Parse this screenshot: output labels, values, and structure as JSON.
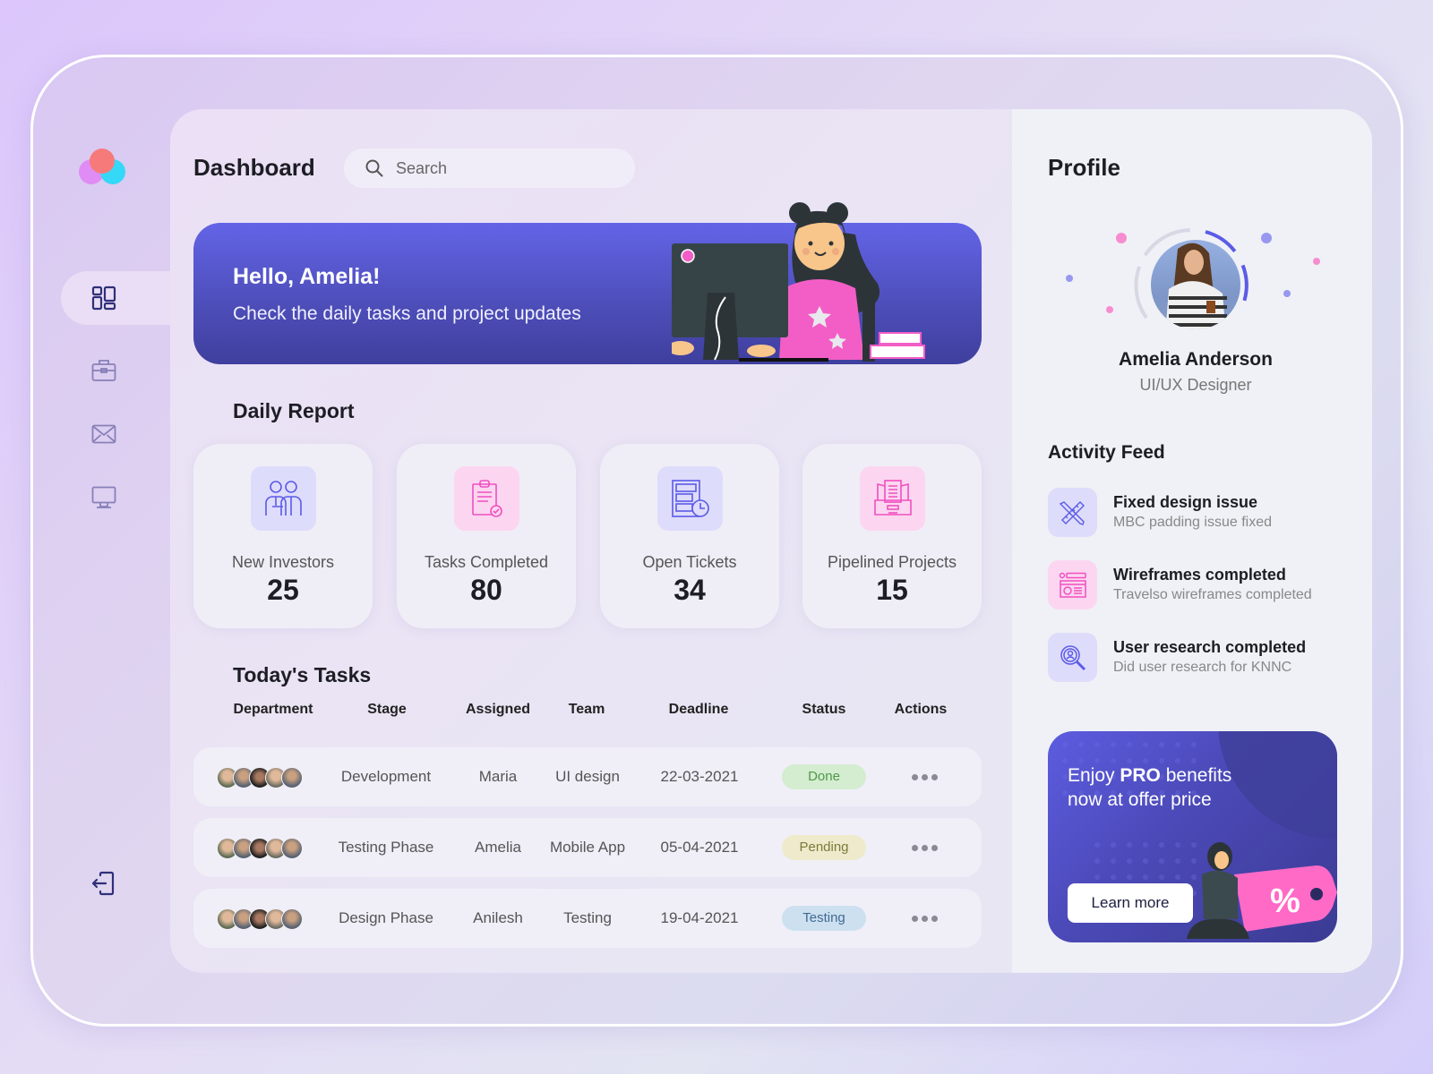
{
  "app": {
    "title": "Dashboard"
  },
  "search": {
    "placeholder": "Search",
    "value": ""
  },
  "sidebar": {
    "items": [
      {
        "name": "dashboard",
        "icon": "grid-icon",
        "active": true
      },
      {
        "name": "projects",
        "icon": "briefcase-icon",
        "active": false
      },
      {
        "name": "messages",
        "icon": "mail-icon",
        "active": false
      },
      {
        "name": "monitor",
        "icon": "monitor-icon",
        "active": false
      }
    ],
    "logout_icon": "logout-icon"
  },
  "hero": {
    "greeting": "Hello, Amelia!",
    "subtitle": "Check the daily tasks and project updates"
  },
  "daily_report": {
    "title": "Daily Report",
    "cards": [
      {
        "label": "New Investors",
        "value": "25",
        "icon": "investors-icon",
        "tint": "#dedcfb",
        "color": "#5b5be6"
      },
      {
        "label": "Tasks Completed",
        "value": "80",
        "icon": "clipboard-check-icon",
        "tint": "#fcd6f0",
        "color": "#f04fc0"
      },
      {
        "label": "Open Tickets",
        "value": "34",
        "icon": "tickets-clock-icon",
        "tint": "#dedcfb",
        "color": "#5b5be6"
      },
      {
        "label": "Pipelined Projects",
        "value": "15",
        "icon": "inbox-tray-icon",
        "tint": "#fcd6f0",
        "color": "#f04fc0"
      }
    ]
  },
  "tasks": {
    "title": "Today's Tasks",
    "columns": [
      "Department",
      "Stage",
      "Assigned",
      "Team",
      "Deadline",
      "Status",
      "Actions"
    ],
    "rows": [
      {
        "stage": "Development",
        "assigned": "Maria",
        "team": "UI design",
        "deadline": "22-03-2021",
        "status": "Done"
      },
      {
        "stage": "Testing Phase",
        "assigned": "Amelia",
        "team": "Mobile App",
        "deadline": "05-04-2021",
        "status": "Pending"
      },
      {
        "stage": "Design Phase",
        "assigned": "Anilesh",
        "team": "Testing",
        "deadline": "19-04-2021",
        "status": "Testing"
      }
    ],
    "status_colors": {
      "Done": {
        "bg": "#d4ecd0",
        "fg": "#4d9a48"
      },
      "Pending": {
        "bg": "#eeeacb",
        "fg": "#7e7a3a"
      },
      "Testing": {
        "bg": "#cde0f0",
        "fg": "#3f6a92"
      }
    }
  },
  "profile": {
    "title": "Profile",
    "name": "Amelia Anderson",
    "role": "UI/UX Designer"
  },
  "activity": {
    "title": "Activity Feed",
    "items": [
      {
        "title": "Fixed design issue",
        "subtitle": "MBC padding issue fixed",
        "icon": "ruler-pencil-icon"
      },
      {
        "title": "Wireframes completed",
        "subtitle": "Travelso wireframes completed",
        "icon": "wireframe-icon"
      },
      {
        "title": "User research completed",
        "subtitle": "Did user research for KNNC",
        "icon": "user-search-icon"
      }
    ]
  },
  "promo": {
    "line1_pre": "Enjoy ",
    "line1_bold": "PRO",
    "line1_post": " benefits",
    "line2": "now at offer price",
    "button": "Learn more",
    "tag_text": "%"
  },
  "colors": {
    "accent": "#5b5be6",
    "pink": "#f04fc0",
    "hero_top": "#6264e6",
    "hero_bottom": "#3f3f9e"
  }
}
